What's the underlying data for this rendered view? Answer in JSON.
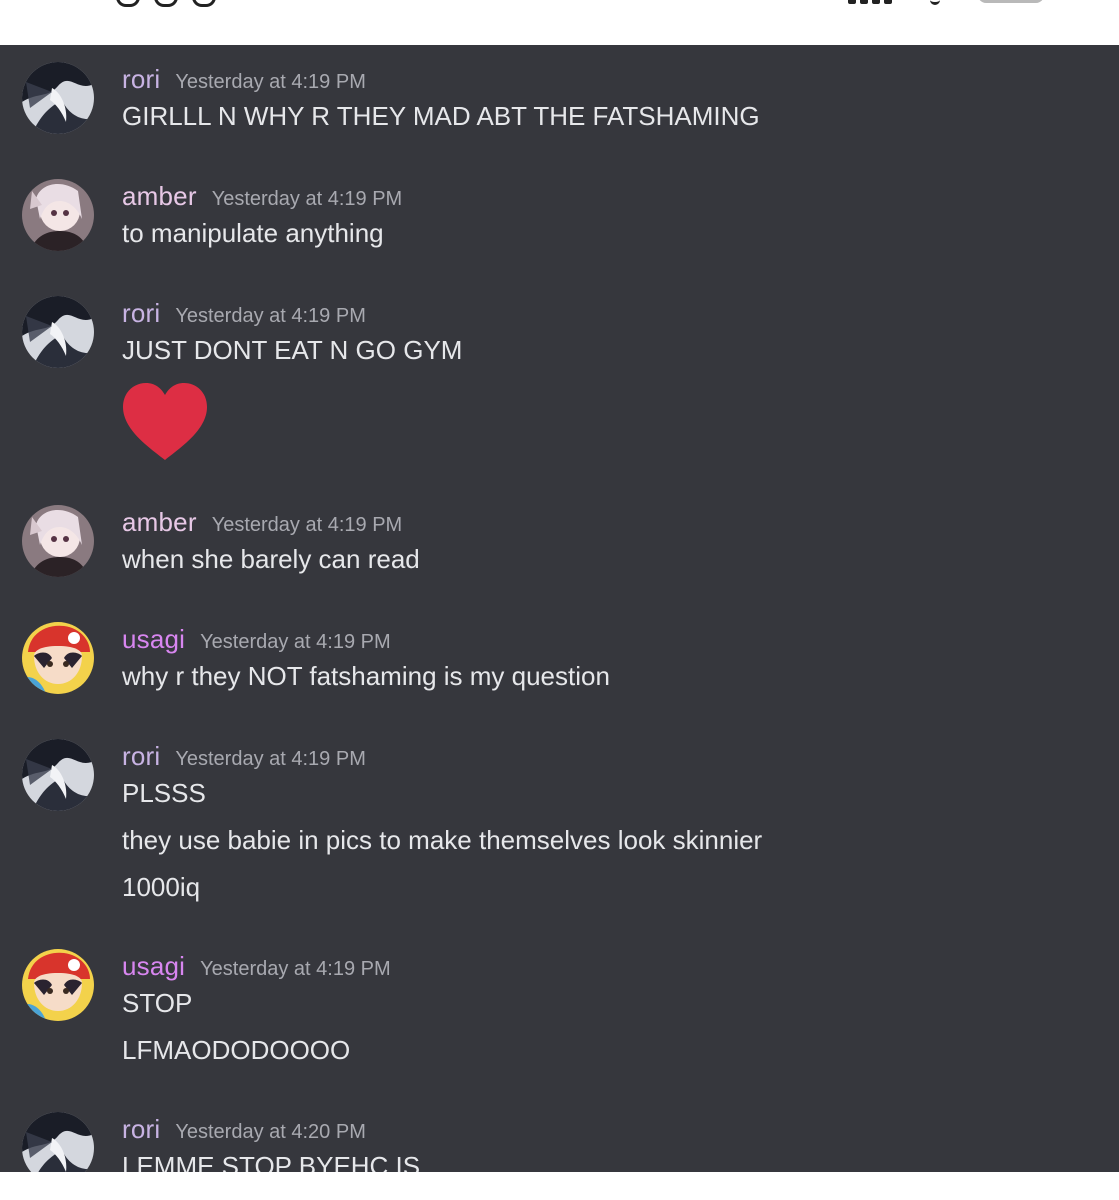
{
  "colors": {
    "background": "#36373d",
    "text": "#e6e7ea",
    "timestamp": "#a8a9b0",
    "user_rori": "#c8b3e3",
    "user_amber": "#e7c8e6",
    "user_usagi": "#d886f0",
    "heart": "#dd2e44"
  },
  "messages": [
    {
      "username": "rori",
      "timestamp": "Yesterday at 4:19 PM",
      "lines": [
        "GIRLLL N WHY R THEY MAD ABT THE FATSHAMING"
      ]
    },
    {
      "username": "amber",
      "timestamp": "Yesterday at 4:19 PM",
      "lines": [
        "to manipulate anything"
      ]
    },
    {
      "username": "rori",
      "timestamp": "Yesterday at 4:19 PM",
      "lines": [
        "JUST DONT EAT N GO GYM"
      ],
      "emoji": "heart-icon"
    },
    {
      "username": "amber",
      "timestamp": "Yesterday at 4:19 PM",
      "lines": [
        "when she barely can read"
      ]
    },
    {
      "username": "usagi",
      "timestamp": "Yesterday at 4:19 PM",
      "lines": [
        "why r they NOT fatshaming is my question"
      ]
    },
    {
      "username": "rori",
      "timestamp": "Yesterday at 4:19 PM",
      "lines": [
        "PLSSS",
        "they use babie in pics to make themselves look skinnier",
        "1000iq"
      ]
    },
    {
      "username": "usagi",
      "timestamp": "Yesterday at 4:19 PM",
      "lines": [
        "STOP",
        "LFMAODODOOOO"
      ]
    },
    {
      "username": "rori",
      "timestamp": "Yesterday at 4:20 PM",
      "lines": [
        "LEMME STOP BYEHC IS"
      ]
    }
  ]
}
